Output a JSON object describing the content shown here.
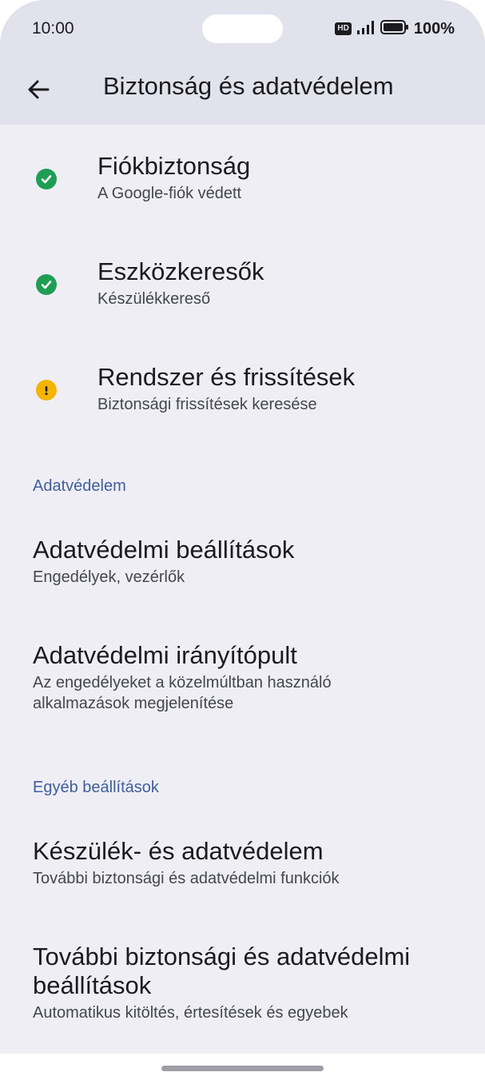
{
  "status_bar": {
    "time": "10:00",
    "hd_label": "HD",
    "battery_percent": "100%",
    "icons": [
      "hd-icon",
      "signal-icon",
      "battery-icon"
    ]
  },
  "app_bar": {
    "title": "Biztonság és adatvédelem",
    "back_icon": "back-arrow-icon"
  },
  "security_items": [
    {
      "title": "Fiókbiztonság",
      "subtitle": "A Google-fiók védett",
      "status": "ok",
      "icon": "check-circle-icon"
    },
    {
      "title": "Eszközkeresők",
      "subtitle": "Készülékkereső",
      "status": "ok",
      "icon": "check-circle-icon"
    },
    {
      "title": "Rendszer és frissítések",
      "subtitle": "Biztonsági frissítések keresése",
      "status": "warning",
      "icon": "warning-circle-icon"
    }
  ],
  "sections": {
    "privacy": {
      "header": "Adatvédelem",
      "items": [
        {
          "title": "Adatvédelmi beállítások",
          "subtitle": "Engedélyek, vezérlők"
        },
        {
          "title": "Adatvédelmi irányítópult",
          "subtitle_line1": "Az engedélyeket a közelmúltban használó",
          "subtitle_line2": "alkalmazások megjelenítése"
        }
      ]
    },
    "other": {
      "header": "Egyéb beállítások",
      "items": [
        {
          "title": "Készülék- és adatvédelem",
          "subtitle": "További biztonsági és adatvédelmi funkciók"
        },
        {
          "title_line1": "További biztonsági és adatvédelmi",
          "title_line2": "beállítások",
          "subtitle": "Automatikus kitöltés, értesítések és egyebek"
        }
      ]
    }
  },
  "colors": {
    "background": "#efeef5",
    "app_bar": "#e2e2ed",
    "accent": "#3f5f9a",
    "ok": "#1f9d55",
    "warning": "#f4b400"
  }
}
